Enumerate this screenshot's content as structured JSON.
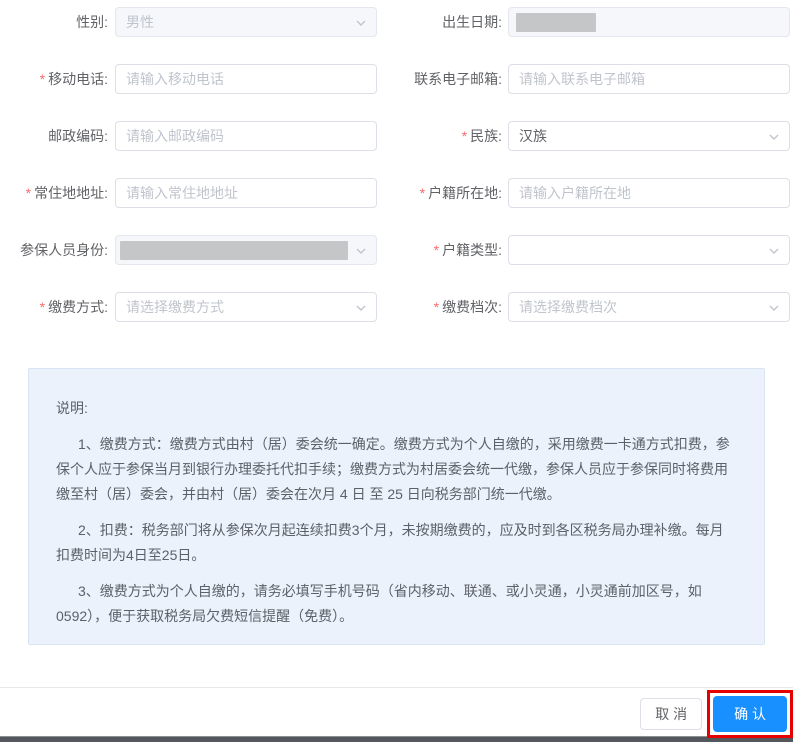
{
  "required_mark": "*",
  "fields": {
    "gender": {
      "label": "性别:",
      "value": "男性"
    },
    "birth_date": {
      "label": "出生日期:"
    },
    "mobile": {
      "label": "移动电话:",
      "placeholder": "请输入移动电话"
    },
    "email": {
      "label": "联系电子邮箱:",
      "placeholder": "请输入联系电子邮箱"
    },
    "postal": {
      "label": "邮政编码:",
      "placeholder": "请输入邮政编码"
    },
    "ethnicity": {
      "label": "民族:",
      "value": "汉族"
    },
    "residence": {
      "label": "常住地地址:",
      "placeholder": "请输入常住地地址"
    },
    "hukou_place": {
      "label": "户籍所在地:",
      "placeholder": "请输入户籍所在地"
    },
    "identity": {
      "label": "参保人员身份:"
    },
    "hukou_type": {
      "label": "户籍类型:",
      "value": ""
    },
    "pay_method": {
      "label": "缴费方式:",
      "placeholder": "请选择缴费方式"
    },
    "pay_tier": {
      "label": "缴费档次:",
      "placeholder": "请选择缴费档次"
    }
  },
  "info": {
    "title": "说明:",
    "paragraphs": [
      "1、缴费方式：缴费方式由村（居）委会统一确定。缴费方式为个人自缴的，采用缴费一卡通方式扣费，参保个人应于参保当月到银行办理委托代扣手续；缴费方式为村居委会统一代缴，参保人员应于参保同时将费用缴至村（居）委会，并由村（居）委会在次月 4 日 至 25 日向税务部门统一代缴。",
      "2、扣费：税务部门将从参保次月起连续扣费3个月，未按期缴费的，应及时到各区税务局办理补缴。每月扣费时间为4日至25日。",
      "3、缴费方式为个人自缴的，请务必填写手机号码（省内移动、联通、或小灵通，小灵通前加区号，如0592），便于获取税务局欠费短信提醒（免费）。"
    ]
  },
  "footer": {
    "cancel_label": "取 消",
    "confirm_label": "确 认"
  },
  "colors": {
    "primary": "#1890ff",
    "annotation_red": "#e60000",
    "required_red": "#f56c6c",
    "info_bg": "#ebf2fb",
    "disabled_bg": "#f5f7fa"
  }
}
